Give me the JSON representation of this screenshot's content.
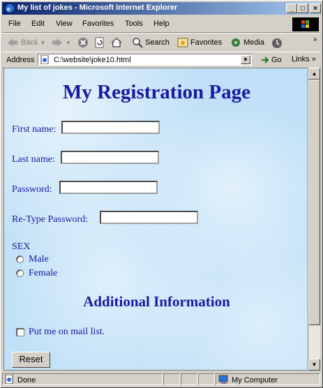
{
  "window": {
    "title": "My list of jokes - Microsoft Internet Explorer"
  },
  "title_buttons": {
    "minimize": "_",
    "maximize": "□",
    "close": "×"
  },
  "menu": [
    {
      "label": "File"
    },
    {
      "label": "Edit"
    },
    {
      "label": "View"
    },
    {
      "label": "Favorites"
    },
    {
      "label": "Tools"
    },
    {
      "label": "Help"
    }
  ],
  "toolbar": {
    "back": "Back",
    "search": "Search",
    "favorites": "Favorites",
    "media": "Media"
  },
  "address": {
    "label": "Address",
    "value": "C:\\website\\joke10.html",
    "go": "Go",
    "links": "Links"
  },
  "page": {
    "heading": "My Registration Page",
    "first_name_label": "First name:",
    "last_name_label": "Last name:",
    "password_label": "Password:",
    "retype_label": "Re-Type Password:",
    "sex_label": "SEX",
    "male": "Male",
    "female": "Female",
    "sub_heading": "Additional Information",
    "mail_list": "Put me on mail list.",
    "reset": "Reset"
  },
  "status": {
    "text": "Done",
    "zone": "My Computer"
  },
  "colors": {
    "link_text": "#1a1aa0",
    "title_bar": "#0a246a"
  }
}
